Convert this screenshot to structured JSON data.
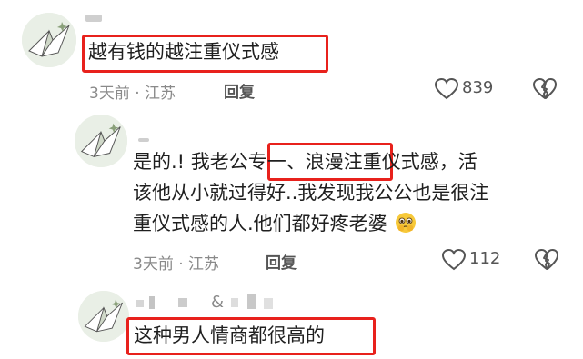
{
  "comments": [
    {
      "text": "越有钱的越注重仪式感",
      "meta": "3天前 · 江苏",
      "reply_label": "回复",
      "likes": "839"
    },
    {
      "lines": [
        "是的.!  我老公专一、浪漫注重仪式感，活",
        "该他从小就过得好..我发现我公公也是很注",
        "重仪式感的人.他们都好疼老婆"
      ],
      "line1_pre": "是的.!  我老公",
      "line1_hl": "专一、浪漫",
      "line1_post": "注重仪式感，活",
      "line2": "该他从小就过得好..我发现我公公也是很注",
      "line3": "重仪式感的人.他们都好疼老婆",
      "meta": "3天前 · 江苏",
      "reply_label": "回复",
      "likes": "112"
    },
    {
      "name_fragment": "&",
      "text": "这种男人情商都很高的"
    }
  ],
  "icons": {
    "like": "heart-outline-icon",
    "dislike": "broken-heart-icon",
    "emoji": "pleading-face-emoji-icon",
    "avatar": "origami-crane-avatar"
  },
  "colors": {
    "highlight": "#e8211c",
    "meta": "#8a8a8a"
  }
}
